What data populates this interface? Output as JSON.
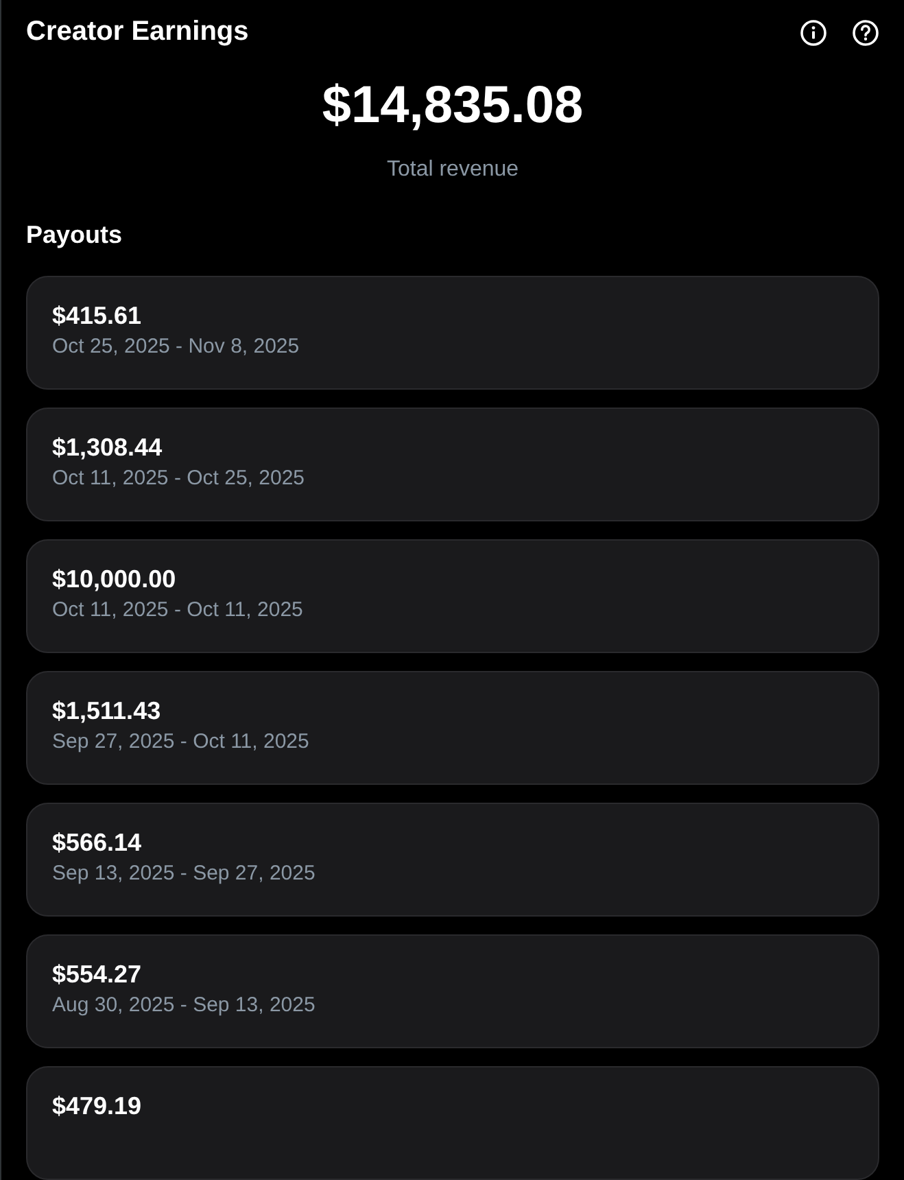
{
  "header": {
    "title": "Creator Earnings"
  },
  "total": {
    "amount": "$14,835.08",
    "label": "Total revenue"
  },
  "payouts": {
    "heading": "Payouts",
    "items": [
      {
        "amount": "$415.61",
        "period": "Oct 25, 2025 - Nov 8, 2025"
      },
      {
        "amount": "$1,308.44",
        "period": "Oct 11, 2025 - Oct 25, 2025"
      },
      {
        "amount": "$10,000.00",
        "period": "Oct 11, 2025 - Oct 11, 2025"
      },
      {
        "amount": "$1,511.43",
        "period": "Sep 27, 2025 - Oct 11, 2025"
      },
      {
        "amount": "$566.14",
        "period": "Sep 13, 2025 - Sep 27, 2025"
      },
      {
        "amount": "$554.27",
        "period": "Aug 30, 2025 - Sep 13, 2025"
      },
      {
        "amount": "$479.19"
      }
    ]
  }
}
